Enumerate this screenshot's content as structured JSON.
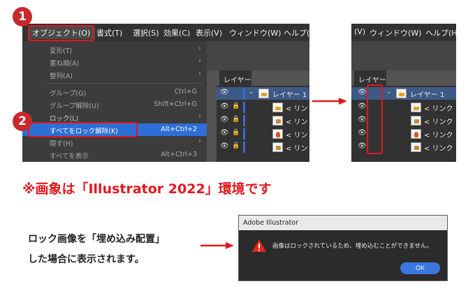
{
  "step_badges": [
    "1",
    "2"
  ],
  "menubar": {
    "items": [
      "オブジェクト(O)",
      "書式(T)",
      "選択(S)",
      "効果(C)",
      "表示(V)",
      "ウィンドウ(W)",
      "ヘルプ("
    ]
  },
  "object_menu": {
    "items": [
      {
        "label": "変形(T)",
        "shortcut": "",
        "submenu": true
      },
      {
        "label": "重ね順(A)",
        "shortcut": "",
        "submenu": true
      },
      {
        "label": "整列(A)",
        "shortcut": "",
        "submenu": true
      },
      {
        "label": "グループ(G)",
        "shortcut": "Ctrl+G",
        "submenu": false
      },
      {
        "label": "グループ解除(U)",
        "shortcut": "Shift+Ctrl+G",
        "submenu": false
      },
      {
        "label": "ロック(L)",
        "shortcut": "",
        "submenu": true
      },
      {
        "label": "すべてをロック解除(K)",
        "shortcut": "Alt+Ctrl+2",
        "submenu": false
      },
      {
        "label": "隠す(H)",
        "shortcut": "",
        "submenu": true
      },
      {
        "label": "すべてを表示",
        "shortcut": "Alt+Ctrl+3",
        "submenu": false
      }
    ],
    "highlighted_index": 6
  },
  "layers_panel": {
    "tab_label": "レイヤー",
    "layer_name": "レイヤー 1",
    "item_label": "< リン",
    "eye_glyph": "👁",
    "lock_glyph": "🔒"
  },
  "right_panel": {
    "menubar": [
      "(V)",
      "ウィンドウ(W)",
      "ヘルプ(H"
    ],
    "tab_label": "レイヤー",
    "layer_name": "レイヤー 1",
    "item_label": "< リンク"
  },
  "caption": "※画象は「Illustrator 2022」環境です",
  "note": {
    "line1": "ロック画像を「埋め込み配置」",
    "line2": "した場合に表示されます。"
  },
  "dialog": {
    "title": "Adobe Illustrator",
    "message": "画像はロックされているため、埋め込むことができません。",
    "ok_label": "OK"
  },
  "colors": {
    "accent_red": "#e0181f",
    "badge_red": "#c8292e",
    "menu_highlight": "#2d6fd6",
    "dialog_button": "#3a78e0"
  }
}
